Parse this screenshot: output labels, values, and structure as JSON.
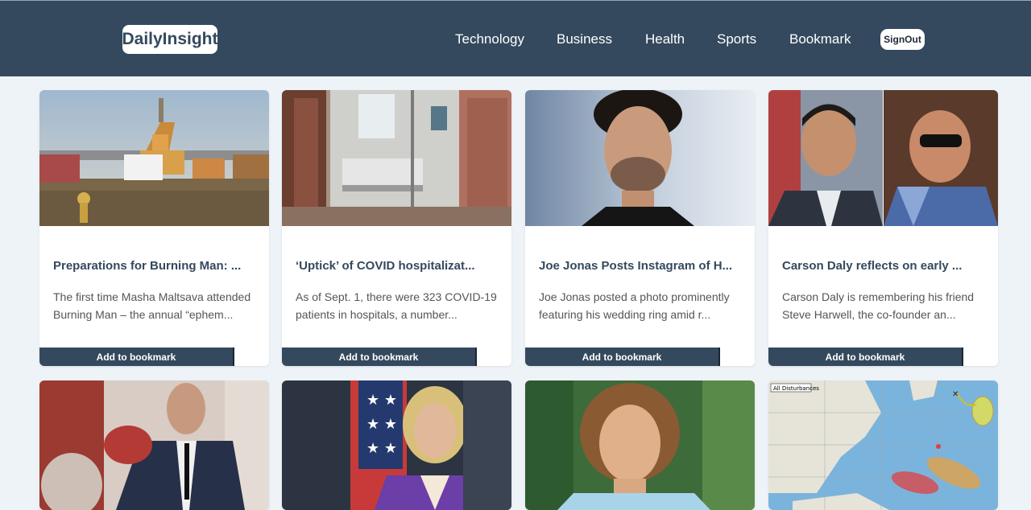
{
  "header": {
    "logo": "DailyInsight",
    "nav": [
      "Technology",
      "Business",
      "Health",
      "Sports",
      "Bookmark"
    ],
    "signout": "SignOut"
  },
  "cards": [
    {
      "image": "burning-man-festival-photo",
      "title": "Preparations for Burning Man: ...",
      "desc_line1": "The first time Masha Maltsava attended",
      "desc_line2": "Burning Man – the annual “ephem...",
      "button": "Add to bookmark"
    },
    {
      "image": "hospital-room-photo",
      "title": "‘Uptick’ of COVID hospitalizat...",
      "desc_line1": "As of Sept. 1, there were 323 COVID-19",
      "desc_line2": "patients in hospitals, a number...",
      "button": "Add to bookmark"
    },
    {
      "image": "joe-jonas-portrait-photo",
      "title": "Joe Jonas Posts Instagram of H...",
      "desc_line1": "Joe Jonas posted a photo prominently",
      "desc_line2": "featuring his wedding ring amid r...",
      "button": "Add to bookmark"
    },
    {
      "image": "carson-daly-and-friend-photo",
      "title": "Carson Daly reflects on early ...",
      "desc_line1": "Carson Daly is remembering his friend",
      "desc_line2": "Steve Harwell, the co-founder an...",
      "button": "Add to bookmark"
    }
  ],
  "row2_images": [
    "man-in-suit-photo",
    "first-lady-flag-photo",
    "curly-haired-man-photo",
    "hurricane-map-image"
  ],
  "map_label": "All Disturbances",
  "colors": {
    "header": "#34495e",
    "background": "#eef3f8",
    "card": "#ffffff"
  }
}
